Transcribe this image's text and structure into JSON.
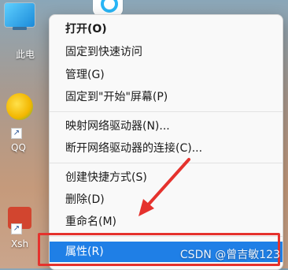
{
  "desktop": {
    "icons": [
      {
        "label": "此电",
        "icon": "computer-icon"
      },
      {
        "label": "QQ",
        "icon": "qq-icon"
      },
      {
        "label": "Xsh",
        "icon": "xshell-icon"
      }
    ]
  },
  "context_menu": {
    "groups": [
      {
        "items": [
          {
            "label": "打开(O)",
            "bold": true
          },
          {
            "label": "固定到快速访问"
          },
          {
            "label": "管理(G)"
          },
          {
            "label": "固定到\"开始\"屏幕(P)"
          }
        ]
      },
      {
        "items": [
          {
            "label": "映射网络驱动器(N)..."
          },
          {
            "label": "断开网络驱动器的连接(C)..."
          }
        ]
      },
      {
        "items": [
          {
            "label": "创建快捷方式(S)"
          },
          {
            "label": "删除(D)"
          },
          {
            "label": "重命名(M)"
          }
        ]
      },
      {
        "items": [
          {
            "label": "属性(R)",
            "highlighted": true
          }
        ]
      }
    ]
  },
  "annotations": {
    "arrow_color": "#e5322d",
    "box_color": "#e5322d"
  },
  "watermark": "CSDN @曾吉敏123",
  "colors": {
    "highlight": "#1f7fe6",
    "menu_bg": "#f9f9f9"
  }
}
